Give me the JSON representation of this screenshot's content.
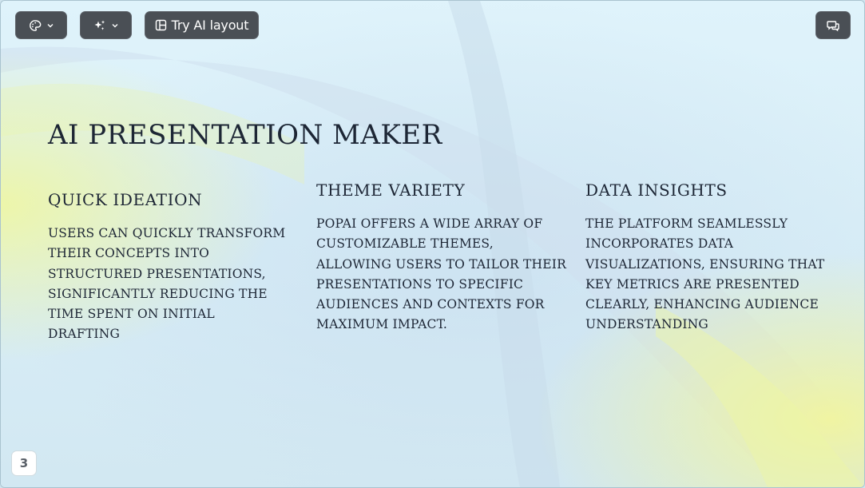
{
  "toolbar": {
    "theme_icon": "palette-icon",
    "ai_icon": "sparkles-icon",
    "layout_icon": "layout-icon",
    "layout_label": "Try AI layout",
    "comment_icon": "comments-icon",
    "dropdown_icon": "chevron-down-icon"
  },
  "slide": {
    "title": "AI Presentation Maker",
    "columns": [
      {
        "heading": "Quick Ideation",
        "lines": [
          "Users can quickly transform",
          "their concepts into",
          "structured presentations,",
          "significantly reducing the",
          "time spent on initial drafting"
        ]
      },
      {
        "heading": "Theme Variety",
        "lines": [
          "PopAi offers a wide array of",
          "customizable themes,",
          "allowing users to tailor their",
          "presentations to specific",
          "audiences and contexts for",
          "maximum impact."
        ]
      },
      {
        "heading": "Data Insights",
        "lines": [
          "The platform seamlessly",
          "incorporates data",
          "visualizations, ensuring that",
          "key metrics are presented",
          "clearly, enhancing audience",
          "understanding"
        ]
      }
    ],
    "page_number": "3"
  },
  "colors": {
    "background": "#d8eef8",
    "accent_yellow": "#e8f3a6",
    "toolbar_button": "#4a4f55",
    "text": "#1d2635"
  }
}
